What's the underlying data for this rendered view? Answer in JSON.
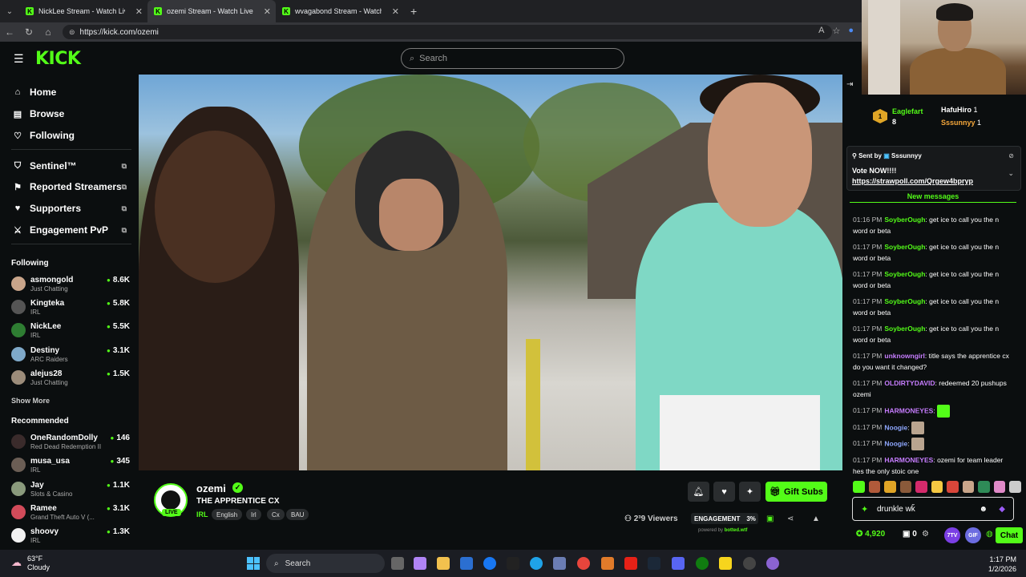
{
  "browser": {
    "tabs": [
      {
        "title": "NickLee Stream - Watch Live o",
        "active": false
      },
      {
        "title": "ozemi Stream - Watch Live on",
        "active": true
      },
      {
        "title": "wvagabond Stream - Watch L",
        "active": false
      }
    ],
    "url": "https://kick.com/ozemi"
  },
  "header": {
    "logo": "KICK",
    "search_placeholder": "Search"
  },
  "sidebar": {
    "nav": [
      {
        "label": "Home",
        "icon": "home-icon"
      },
      {
        "label": "Browse",
        "icon": "browse-icon"
      },
      {
        "label": "Following",
        "icon": "heart-icon"
      }
    ],
    "tools": [
      {
        "label": "Sentinel™",
        "icon": "shield-icon"
      },
      {
        "label": "Reported Streamers",
        "icon": "flag-icon"
      },
      {
        "label": "Supporters",
        "icon": "heart-icon"
      },
      {
        "label": "Engagement PvP",
        "icon": "swords-icon"
      }
    ],
    "following_title": "Following",
    "following": [
      {
        "name": "asmongold",
        "category": "Just Chatting",
        "viewers": "8.6K"
      },
      {
        "name": "Kingteka",
        "category": "IRL",
        "viewers": "5.8K"
      },
      {
        "name": "NickLee",
        "category": "IRL",
        "viewers": "5.5K"
      },
      {
        "name": "Destiny",
        "category": "ARC Raiders",
        "viewers": "3.1K"
      },
      {
        "name": "alejus28",
        "category": "Just Chatting",
        "viewers": "1.5K"
      }
    ],
    "show_more": "Show More",
    "recommended_title": "Recommended",
    "recommended": [
      {
        "name": "OneRandomDolly",
        "category": "Red Dead Redemption II",
        "viewers": "146"
      },
      {
        "name": "musa_usa",
        "category": "IRL",
        "viewers": "345"
      },
      {
        "name": "Jay",
        "category": "Slots & Casino",
        "viewers": "1.1K"
      },
      {
        "name": "Ramee",
        "category": "Grand Theft Auto V (...",
        "viewers": "3.1K"
      },
      {
        "name": "shoovy",
        "category": "IRL",
        "viewers": "1.3K"
      }
    ]
  },
  "stream": {
    "streamer": "ozemi",
    "live_label": "LIVE",
    "title": "THE APPRENTICE CX",
    "category": "IRL",
    "tags": [
      "English",
      "Irl",
      "Cx",
      "BAU"
    ],
    "gift_subs": "Gift Subs",
    "viewers": "2³9 Viewers",
    "engagement_label": "ENGAGEMENT",
    "engagement_value": "3%",
    "powered_by": "powered by",
    "powered_brand": "botted.wtf"
  },
  "chat": {
    "top_gifters": [
      {
        "name": "Eaglefart",
        "count": "8"
      },
      {
        "name": "HafuHiro",
        "count": "1"
      },
      {
        "name": "Sssunnyy",
        "count": "1"
      }
    ],
    "pinned": {
      "sent_by": "Sent by",
      "sender": "Sssunnyy",
      "message": "Vote NOW!!!!",
      "link": "https://strawpoll.com/Qrgew4bpryp"
    },
    "new_messages": "New messages",
    "messages": [
      {
        "time": "01:16 PM",
        "user": "SoyberOugh",
        "color": "#53fc18",
        "text": "get ice to call you the n word or beta"
      },
      {
        "time": "01:17 PM",
        "user": "SoyberOugh",
        "color": "#53fc18",
        "text": "get ice to call you the n word or beta"
      },
      {
        "time": "01:17 PM",
        "user": "SoyberOugh",
        "color": "#53fc18",
        "text": "get ice to call you the n word or beta"
      },
      {
        "time": "01:17 PM",
        "user": "SoyberOugh",
        "color": "#53fc18",
        "text": "get ice to call you the n word or beta"
      },
      {
        "time": "01:17 PM",
        "user": "SoyberOugh",
        "color": "#53fc18",
        "text": "get ice to call you the n word or beta"
      },
      {
        "time": "01:17 PM",
        "user": "unknowngirl",
        "color": "#c77dff",
        "text": "title says the apprentice cx do you want it changed?"
      },
      {
        "time": "01:17 PM",
        "user": "OLDIRTYDAVID",
        "color": "#c77dff",
        "text": "redeemed 20 pushups ozemi"
      },
      {
        "time": "01:17 PM",
        "user": "HARMONEYES",
        "color": "#c77dff",
        "text": ""
      },
      {
        "time": "01:17 PM",
        "user": "Noogie",
        "color": "#8fa8ff",
        "text": ""
      },
      {
        "time": "01:17 PM",
        "user": "Noogie",
        "color": "#8fa8ff",
        "text": ""
      },
      {
        "time": "01:17 PM",
        "user": "HARMONEYES",
        "color": "#c77dff",
        "text": "ozemi for team leader hes the only stoic one"
      }
    ],
    "input_value": "drunkle wǩ",
    "points": "4,920",
    "claim_count": "0",
    "footer_badges": [
      "7TV",
      "GIF"
    ],
    "chat_button": "Chat"
  },
  "taskbar": {
    "temperature": "63°F",
    "condition": "Cloudy",
    "search": "Search",
    "time": "1:17 PM",
    "date": "1/2/2026"
  }
}
